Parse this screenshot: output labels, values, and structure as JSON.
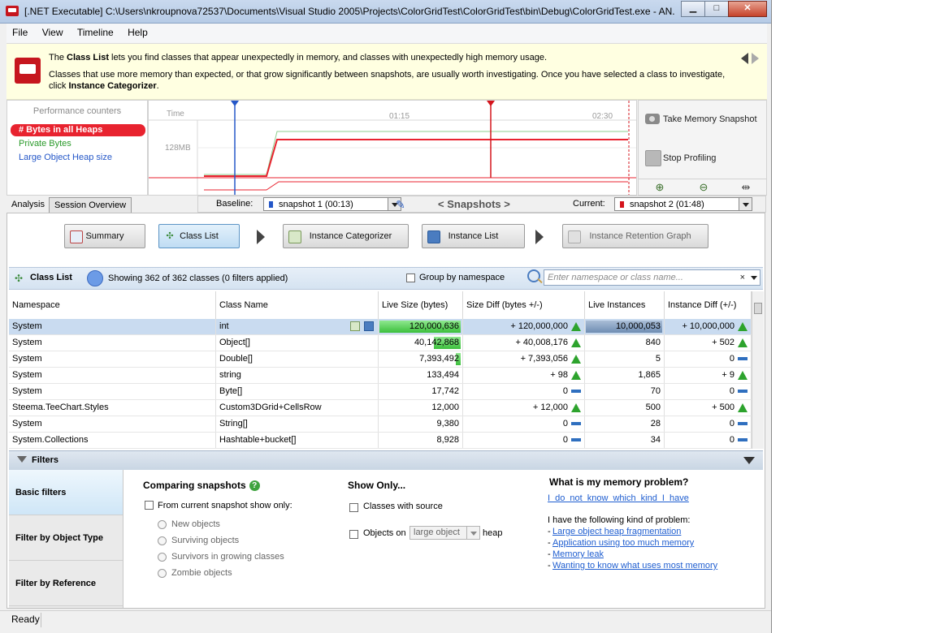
{
  "window": {
    "title": "[.NET Executable] C:\\Users\\nkroupnova72537\\Documents\\Visual Studio 2005\\Projects\\ColorGridTest\\ColorGridTest\\bin\\Debug\\ColorGridTest.exe - AN...",
    "minimize": "▁",
    "maximize": "□",
    "close": "✕"
  },
  "menu": [
    "File",
    "View",
    "Timeline",
    "Help"
  ],
  "banner": {
    "p1_pre": "The ",
    "p1_bold": "Class List",
    "p1_post": " lets you find classes that appear unexpectedly in memory, and classes with unexpectedly high memory usage.",
    "p2_pre": "Classes that use more memory than expected, or that grow significantly between snapshots, are usually worth investigating. Once you have selected a class to investigate, click ",
    "p2_bold": "Instance Categorizer",
    "p2_post": "."
  },
  "perf": {
    "title": "Performance counters",
    "items": [
      "# Bytes in all Heaps",
      "Private Bytes",
      "Large Object Heap size"
    ],
    "colors": [
      "#e8232f",
      "#2a9a2a",
      "#2457c8"
    ]
  },
  "timeline": {
    "time_label": "Time",
    "ticks": [
      "01:15",
      "02:30"
    ],
    "ylabel": "128MB"
  },
  "controls": {
    "take_snapshot": "Take Memory Snapshot",
    "stop_profiling": "Stop Profiling",
    "zoom_in": "⊕",
    "zoom_out": "⊖",
    "zoom_fit": "⇹"
  },
  "tabs": {
    "analysis": "Analysis",
    "session": "Session Overview"
  },
  "baseline": {
    "label": "Baseline:",
    "value": "snapshot 1 (00:13)",
    "snapshots_nav": "< Snapshots >",
    "current_label": "Current:",
    "current_value": "snapshot 2 (01:48)"
  },
  "steps": {
    "summary": "Summary",
    "class_list": "Class List",
    "instance_categorizer": "Instance Categorizer",
    "instance_list": "Instance List",
    "instance_retention_graph": "Instance Retention Graph"
  },
  "classlist": {
    "title": "Class List",
    "showing": "Showing 362 of 362 classes (0 filters applied)",
    "group_label": "Group by namespace",
    "search_placeholder": "Enter namespace or class name...",
    "search_clear": "×"
  },
  "table": {
    "headers": [
      "Namespace",
      "Class Name",
      "Live Size (bytes)",
      "Size Diff (bytes +/-)",
      "Live Instances",
      "Instance Diff (+/-)"
    ],
    "rows": [
      {
        "ns": "System",
        "cls": "int",
        "live": "120,000,636",
        "sdiff": "+ 120,000,000",
        "strend": "up",
        "inst": "10,000,053",
        "idiff": "+ 10,000,000",
        "itrend": "up",
        "live_frac": 1.0,
        "inst_frac": 1.0
      },
      {
        "ns": "System",
        "cls": "Object[]",
        "live": "40,142,868",
        "sdiff": "+ 40,008,176",
        "strend": "up",
        "inst": "840",
        "idiff": "+ 502",
        "itrend": "up",
        "live_frac": 0.334,
        "inst_frac": 0.0
      },
      {
        "ns": "System",
        "cls": "Double[]",
        "live": "7,393,492",
        "sdiff": "+ 7,393,056",
        "strend": "up",
        "inst": "5",
        "idiff": "0",
        "itrend": "flat",
        "live_frac": 0.06,
        "inst_frac": 0.0
      },
      {
        "ns": "System",
        "cls": "string",
        "live": "133,494",
        "sdiff": "+ 98",
        "strend": "up",
        "inst": "1,865",
        "idiff": "+ 9",
        "itrend": "up",
        "live_frac": 0.0,
        "inst_frac": 0.0
      },
      {
        "ns": "System",
        "cls": "Byte[]",
        "live": "17,742",
        "sdiff": "0",
        "strend": "flat",
        "inst": "70",
        "idiff": "0",
        "itrend": "flat",
        "live_frac": 0.0,
        "inst_frac": 0.0
      },
      {
        "ns": "Steema.TeeChart.Styles",
        "cls": "Custom3DGrid+CellsRow",
        "live": "12,000",
        "sdiff": "+ 12,000",
        "strend": "up",
        "inst": "500",
        "idiff": "+ 500",
        "itrend": "up",
        "live_frac": 0.0,
        "inst_frac": 0.0
      },
      {
        "ns": "System",
        "cls": "String[]",
        "live": "9,380",
        "sdiff": "0",
        "strend": "flat",
        "inst": "28",
        "idiff": "0",
        "itrend": "flat",
        "live_frac": 0.0,
        "inst_frac": 0.0
      },
      {
        "ns": "System.Collections",
        "cls": "Hashtable+bucket[]",
        "live": "8,928",
        "sdiff": "0",
        "strend": "flat",
        "inst": "34",
        "idiff": "0",
        "itrend": "flat",
        "live_frac": 0.0,
        "inst_frac": 0.0
      }
    ]
  },
  "filters": {
    "title": "Filters",
    "side": [
      "Basic filters",
      "Filter by Object Type",
      "Filter by Reference"
    ],
    "comparing_title": "Comparing snapshots",
    "from_current": "From current snapshot show only:",
    "radios": [
      "New objects",
      "Surviving objects",
      "Survivors in growing classes",
      "Zombie objects"
    ],
    "show_only_title": "Show Only...",
    "classes_with_source": "Classes with source",
    "objects_on": "Objects on",
    "heap_value": "large object",
    "heap_suffix": "heap",
    "problem_title": "What is my memory problem?",
    "dont_know": "I do not know which kind I have",
    "have_following": "I have the following kind of problem:",
    "problems": [
      "Large object heap fragmentation",
      "Application using too much memory",
      "Memory leak",
      "Wanting to know what uses most memory"
    ]
  },
  "status": "Ready"
}
